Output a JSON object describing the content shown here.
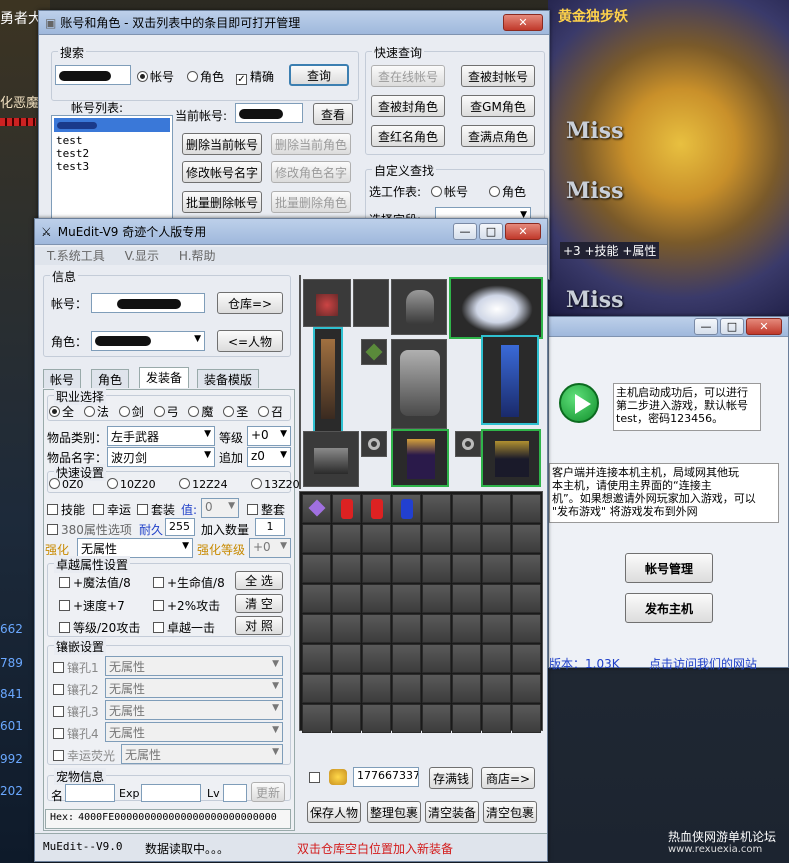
{
  "background": {
    "top_left_banner": "勇者大",
    "left_label": "化恶魔",
    "top_right_banner": "黄金独步妖",
    "miss": [
      "Miss",
      "Miss",
      "Miss"
    ],
    "buff_text": "+3 +技能 +属性",
    "left_numbers": [
      "662",
      "789",
      "841",
      "601",
      "992",
      "202"
    ]
  },
  "win1": {
    "title": "账号和角色 - 双击列表中的条目即可打开管理",
    "search_group": "搜索",
    "radio_account": "帐号",
    "radio_role": "角色",
    "check_exact": "精确",
    "query": "查询",
    "account_list_label": "帐号列表:",
    "accounts": [
      "test",
      "test2",
      "test3"
    ],
    "current_account_label": "当前帐号:",
    "view": "查看",
    "btn_delete_account": "删除当前帐号",
    "btn_delete_role": "删除当前角色",
    "btn_rename_account": "修改帐号名字",
    "btn_rename_role": "修改角色名字",
    "btn_batch_delete_account": "批量删除帐号",
    "btn_batch_delete_role": "批量删除角色",
    "quick_group": "快速查询",
    "q_online": "查在线帐号",
    "q_banned_acc": "查被封帐号",
    "q_banned_role": "查被封角色",
    "q_gm": "查GM角色",
    "q_red": "查红名角色",
    "q_full": "查满点角色",
    "custom_group": "自定义查找",
    "select_table": "选工作表:",
    "custom_acc": "帐号",
    "custom_role": "角色",
    "select_field": "选择字段:"
  },
  "win3": {
    "info_text": "主机启动成功后，可以进行第二步进入游戏，默认帐号test，密码123456。",
    "info2": "客户端并连接本机主机，局域网其他玩\n本主机，请使用主界面的“连接主\n机”。如果想邀请外网玩家加入游戏，可以\n\"发布游戏\" 将游戏发布到外网",
    "btn_account": "帐号管理",
    "btn_publish": "发布主机",
    "version": "版本：1.03K",
    "link": "点击访问我们的网站"
  },
  "main": {
    "title": "MuEdit-V9  奇迹个人版专用",
    "menu": [
      "T.系统工具",
      "V.显示",
      "H.帮助"
    ],
    "info_group": "信息",
    "account_label": "帐号：",
    "warehouse_btn": "仓库=>",
    "role_label": "角色：",
    "person_btn": "<=人物",
    "tabs": [
      "帐号",
      "角色",
      "发装备",
      "装备模版"
    ],
    "class_group": "职业选择",
    "classes": [
      "全",
      "法",
      "剑",
      "弓",
      "魔",
      "圣",
      "召"
    ],
    "item_type_label": "物品类别：",
    "item_type": "左手武器",
    "level_label": "等级",
    "level": "+0",
    "item_name_label": "物品名字：",
    "item_name": "波刃剑",
    "add_label": "追加",
    "add": "z0",
    "quick_group": "快速设置",
    "quick": [
      "0Z0",
      "10Z20",
      "12Z24",
      "13Z20"
    ],
    "skill": "技能",
    "luck": "幸运",
    "set": "套装",
    "value_label": "值:",
    "value": "0",
    "whole_set": "整套",
    "attr380": "380属性选项",
    "durability_label": "耐久",
    "durability": "255",
    "add_count_label": "加入数量",
    "add_count": "1",
    "enhance_label": "强化",
    "enhance": "无属性",
    "enhance_level_label": "强化等级",
    "enhance_level": "+0",
    "excellent_group": "卓越属性设置",
    "exc": [
      "+魔法值/8",
      "+生命值/8",
      "+速度+7",
      "+2%攻击",
      "等级/20攻击",
      "卓越一击"
    ],
    "select_all": "全 选",
    "clear": "清 空",
    "compare": "对 照",
    "socket_group": "镶嵌设置",
    "sockets": [
      "镶孔1",
      "镶孔2",
      "镶孔3",
      "镶孔4"
    ],
    "socket_value": "无属性",
    "luck_glow": "幸运荧光",
    "luck_glow_value": "无属性",
    "pet_group": "宠物信息",
    "pet_name": "名",
    "pet_exp": "Exp",
    "pet_lv": "Lv",
    "refresh": "更新",
    "hex_label": "Hex:",
    "hex": "4000FE000000000000000000000000000",
    "gold": "177667337",
    "deposit": "存满钱",
    "shop": "商店=>",
    "save_person": "保存人物",
    "sort_pack": "整理包裹",
    "clear_equip": "清空装备",
    "clear_pack": "清空包裹",
    "status_left": "MuEdit--V9.0",
    "status_mid": "数据读取中。。。",
    "status_hint": "双击仓库空白位置加入新装备"
  },
  "watermark": {
    "cn": "热血侠网游单机论坛",
    "url": "www.rexuexia.com"
  }
}
